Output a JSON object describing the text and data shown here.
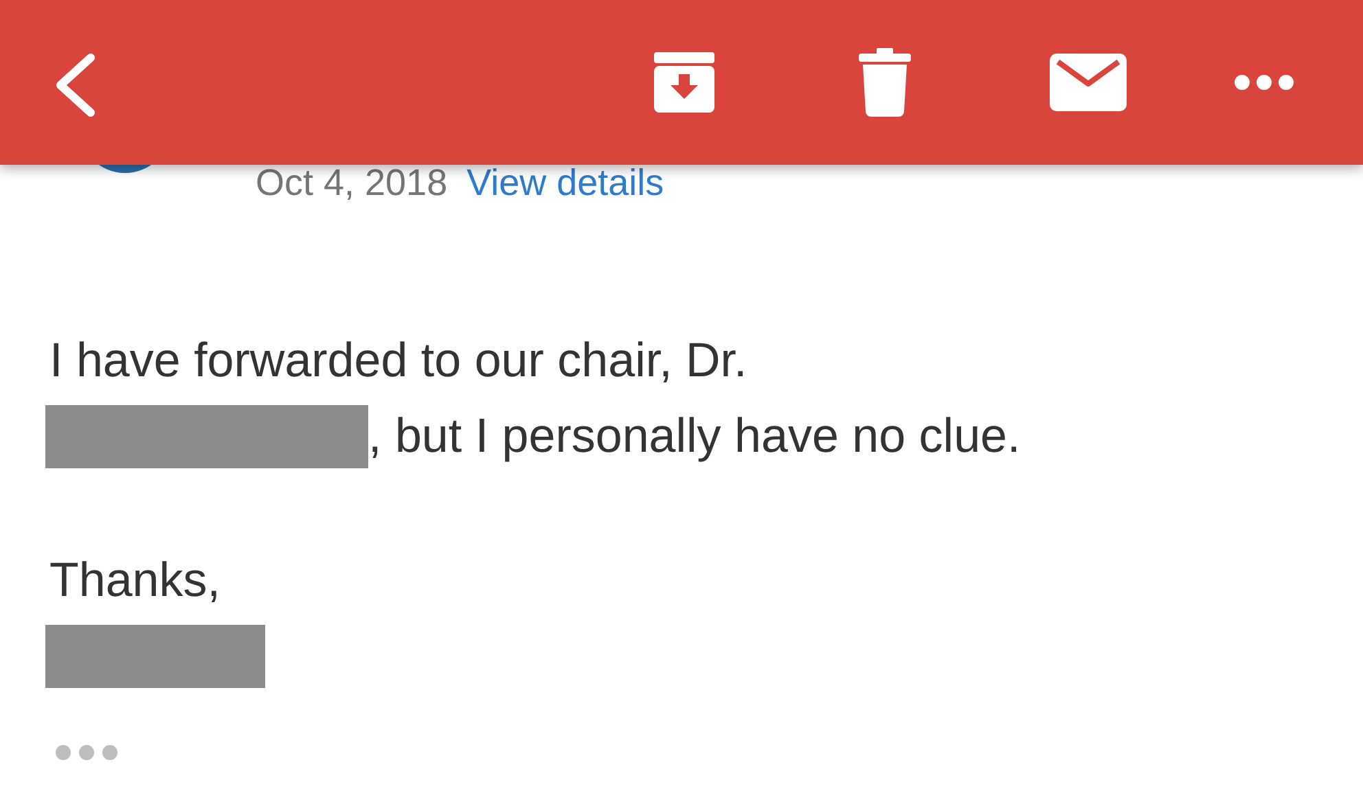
{
  "toolbar": {
    "actions": [
      {
        "kind": "archive"
      },
      {
        "kind": "delete"
      },
      {
        "kind": "mark-unread"
      },
      {
        "kind": "more"
      }
    ]
  },
  "message": {
    "date": "Oct 4, 2018",
    "details_link": "View details",
    "paragraphs": [
      {
        "lines": [
          [
            {
              "kind": "text",
              "text": "I have forwarded to our chair, Dr."
            }
          ],
          [
            {
              "kind": "redacted"
            },
            {
              "kind": "text",
              "text": ", but I personally have no clue."
            }
          ]
        ]
      },
      {
        "lines": [
          [
            {
              "kind": "text",
              "text": "Thanks,"
            }
          ],
          [
            {
              "kind": "redacted"
            }
          ]
        ]
      }
    ]
  }
}
